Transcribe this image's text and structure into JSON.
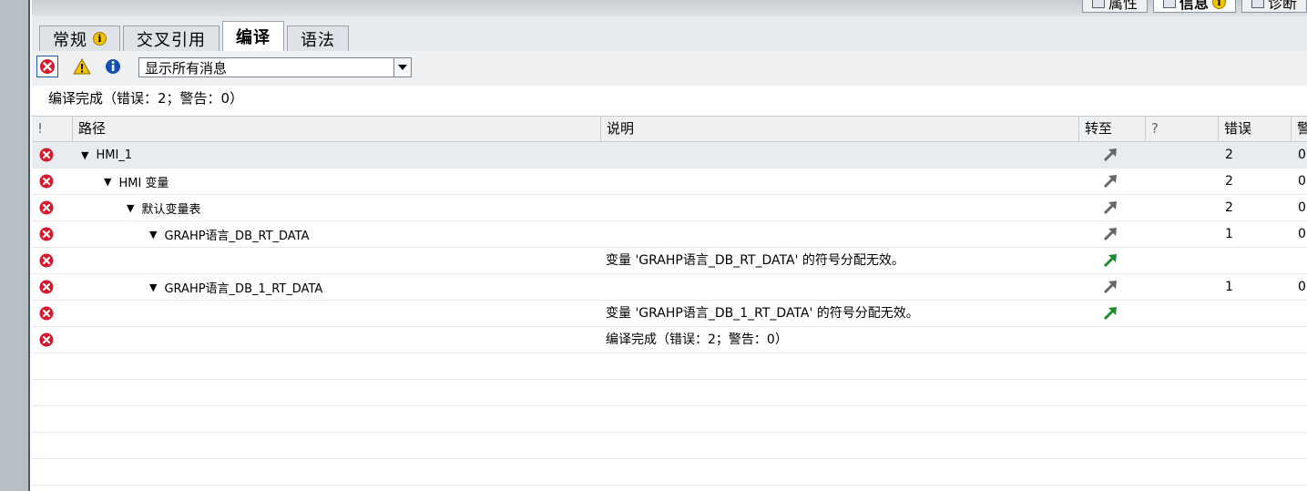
{
  "top_tabs": [
    {
      "label": "属性",
      "active": false
    },
    {
      "label": "信息",
      "active": true
    },
    {
      "label": "诊断",
      "active": false
    }
  ],
  "tabs": [
    {
      "label": "常规",
      "has_info": true,
      "active": false
    },
    {
      "label": "交叉引用",
      "has_info": false,
      "active": false
    },
    {
      "label": "编译",
      "has_info": false,
      "active": true
    },
    {
      "label": "语法",
      "has_info": false,
      "active": false
    }
  ],
  "filter": {
    "select_value": "显示所有消息"
  },
  "summary": "编译完成（错误：2；警告：0）",
  "columns": {
    "bang": "!",
    "path": "路径",
    "description": "说明",
    "goto": "转至",
    "question": "?",
    "errors": "错误",
    "warnings": "警"
  },
  "rows": [
    {
      "indent": 0,
      "expander": "▼",
      "path": "HMI_1",
      "description": "",
      "goto_color": "#666666",
      "errors": "2",
      "warnings": "0"
    },
    {
      "indent": 1,
      "expander": "▼",
      "path": "HMI 变量",
      "description": "",
      "goto_color": "#666666",
      "errors": "2",
      "warnings": "0"
    },
    {
      "indent": 2,
      "expander": "▼",
      "path": "默认变量表",
      "description": "",
      "goto_color": "#666666",
      "errors": "2",
      "warnings": "0"
    },
    {
      "indent": 3,
      "expander": "▼",
      "path": "GRAHP语言_DB_RT_DATA",
      "description": "",
      "goto_color": "#666666",
      "errors": "1",
      "warnings": "0"
    },
    {
      "indent": 4,
      "expander": "",
      "path": "",
      "description": "变量 'GRAHP语言_DB_RT_DATA' 的符号分配无效。",
      "goto_color": "#1f8a2e",
      "errors": "",
      "warnings": ""
    },
    {
      "indent": 3,
      "expander": "▼",
      "path": "GRAHP语言_DB_1_RT_DATA",
      "description": "",
      "goto_color": "#666666",
      "errors": "1",
      "warnings": "0"
    },
    {
      "indent": 4,
      "expander": "",
      "path": "",
      "description": "变量 'GRAHP语言_DB_1_RT_DATA' 的符号分配无效。",
      "goto_color": "#1f8a2e",
      "errors": "",
      "warnings": ""
    },
    {
      "indent": 4,
      "expander": "",
      "path": "",
      "description": "编译完成（错误：2；警告：0）",
      "goto_color": "",
      "errors": "",
      "warnings": ""
    }
  ],
  "colors": {
    "error_red": "#d8182c",
    "warning_yellow": "#f5c400",
    "info_blue": "#1450b4"
  }
}
